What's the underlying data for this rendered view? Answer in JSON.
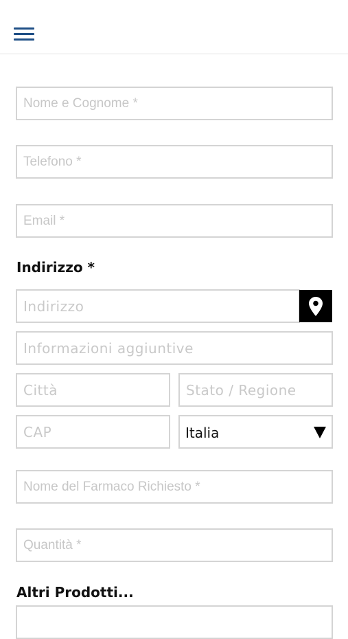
{
  "header": {
    "menu_icon": "hamburger-menu-icon",
    "menu_color": "#1f4f86"
  },
  "form": {
    "name_placeholder": "Nome e Cognome *",
    "phone_placeholder": "Telefono *",
    "email_placeholder": "Email *",
    "address_label": "Indirizzo *",
    "address_placeholder": "Indirizzo",
    "location_icon": "map-pin-icon",
    "extra_info_placeholder": "Informazioni aggiuntive",
    "city_placeholder": "Città",
    "state_placeholder": "Stato / Regione",
    "zip_placeholder": "CAP",
    "country_value": "Italia",
    "drug_name_placeholder": "Nome del Farmaco Richiesto *",
    "quantity_placeholder": "Quantità *",
    "other_products_label": "Altri Prodotti..."
  }
}
